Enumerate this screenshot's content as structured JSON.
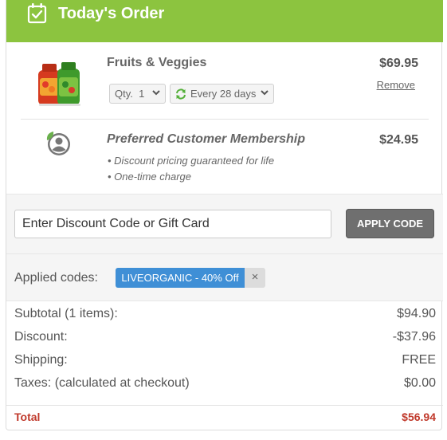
{
  "header": {
    "title": "Today's Order",
    "icon": "calendar-check-icon",
    "color": "#8cc43f"
  },
  "items": [
    {
      "name": "Fruits & Veggies",
      "price": "$69.95",
      "remove_label": "Remove",
      "qty_label": "Qty.",
      "qty_value": "1",
      "frequency": "Every 28 days"
    },
    {
      "name": "Preferred Customer Membership",
      "price": "$24.95",
      "bullets": [
        "• Discount pricing guaranteed for life",
        "• One-time charge"
      ]
    }
  ],
  "discount": {
    "placeholder": "Enter Discount Code or Gift Card",
    "apply_label": "APPLY CODE"
  },
  "codes": {
    "label": "Applied codes:",
    "applied": "LIVEORGANIC - 40% Off",
    "remove_symbol": "×",
    "chip_color": "#3f8fd6"
  },
  "totals": {
    "subtotal_label": "Subtotal (1 items):",
    "subtotal": "$94.90",
    "discount_label": "Discount:",
    "discount": "-$37.96",
    "shipping_label": "Shipping:",
    "shipping": "FREE",
    "taxes_label": "Taxes: (calculated at checkout)",
    "taxes": "$0.00",
    "total_label": "Total",
    "total": "$56.94",
    "total_color": "#c0392b"
  }
}
